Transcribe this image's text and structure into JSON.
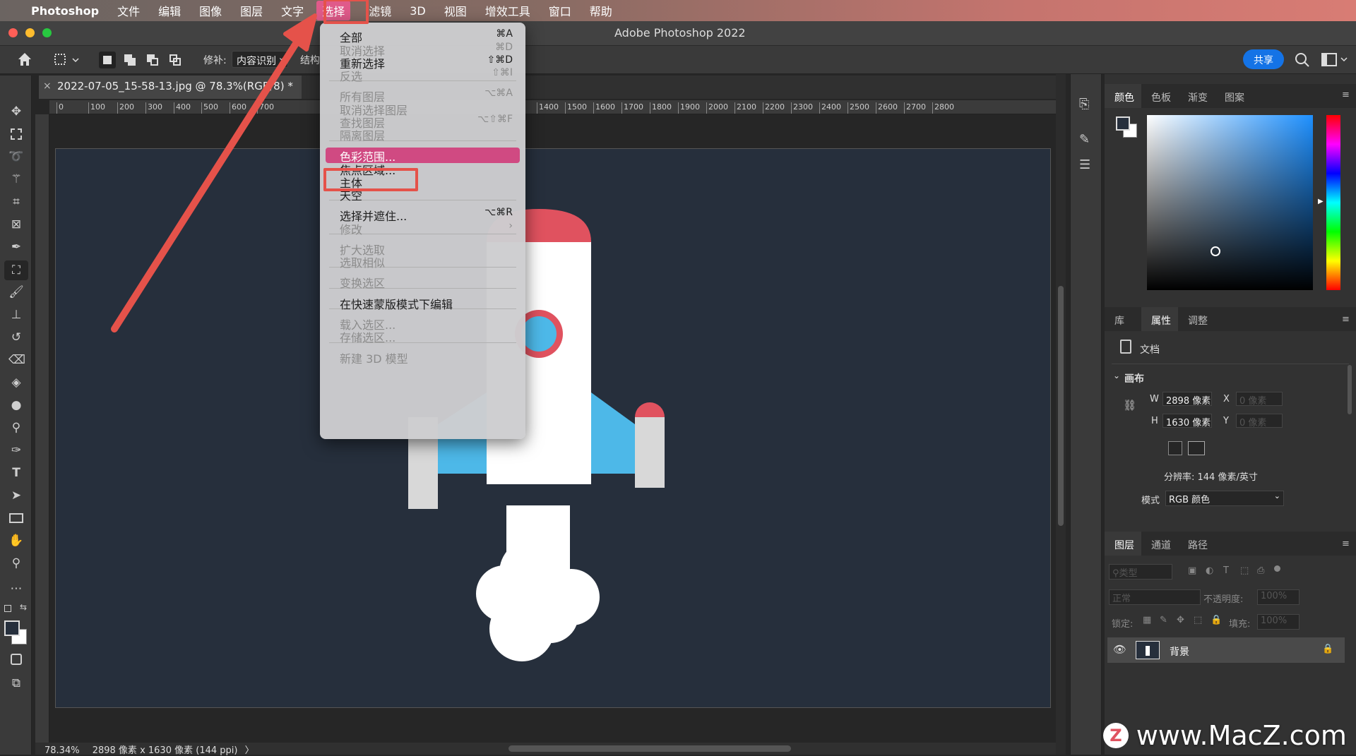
{
  "menubar": {
    "apple": "",
    "app_name": "Photoshop",
    "items": [
      "文件",
      "编辑",
      "图像",
      "图层",
      "文字"
    ],
    "active": "选择",
    "items_after": [
      "滤镜",
      "3D",
      "视图",
      "增效工具",
      "窗口",
      "帮助"
    ]
  },
  "window": {
    "title": "Adobe Photoshop 2022",
    "share_label": "共享"
  },
  "options_bar": {
    "patch_label": "修补:",
    "patch_value": "内容识别",
    "structure_label": "结构"
  },
  "document": {
    "tab_title": "2022-07-05_15-58-13.jpg @ 78.3%(RGB/8) *",
    "close": "×"
  },
  "ruler": {
    "ticks": [
      "0",
      "100",
      "200",
      "300",
      "400",
      "500",
      "600",
      "700",
      "1400",
      "1500",
      "1600",
      "1700",
      "1800",
      "1900",
      "2000",
      "2100",
      "2200",
      "2300",
      "2400",
      "2500",
      "2600",
      "2700",
      "2800"
    ]
  },
  "status": {
    "zoom": "78.34%",
    "info": "2898 像素 x 1630 像素 (144 ppi)",
    "arrow": "〉"
  },
  "select_menu": {
    "items": [
      {
        "label": "全部",
        "shortcut": "⌘A",
        "disabled": false
      },
      {
        "label": "取消选择",
        "shortcut": "⌘D",
        "disabled": true
      },
      {
        "label": "重新选择",
        "shortcut": "⇧⌘D",
        "disabled": false
      },
      {
        "label": "反选",
        "shortcut": "⇧⌘I",
        "disabled": true
      },
      {
        "label": "所有图层",
        "shortcut": "⌥⌘A",
        "disabled": true
      },
      {
        "label": "取消选择图层",
        "shortcut": "",
        "disabled": true
      },
      {
        "label": "查找图层",
        "shortcut": "⌥⇧⌘F",
        "disabled": true
      },
      {
        "label": "隔离图层",
        "shortcut": "",
        "disabled": true
      },
      {
        "label": "色彩范围...",
        "shortcut": "",
        "disabled": false,
        "highlighted": true
      },
      {
        "label": "焦点区域...",
        "shortcut": "",
        "disabled": false
      },
      {
        "label": "主体",
        "shortcut": "",
        "disabled": false
      },
      {
        "label": "天空",
        "shortcut": "",
        "disabled": false
      },
      {
        "label": "选择并遮住...",
        "shortcut": "⌥⌘R",
        "disabled": false
      },
      {
        "label": "修改",
        "shortcut": "›",
        "disabled": true
      },
      {
        "label": "扩大选取",
        "shortcut": "",
        "disabled": true
      },
      {
        "label": "选取相似",
        "shortcut": "",
        "disabled": true
      },
      {
        "label": "变换选区",
        "shortcut": "",
        "disabled": true
      },
      {
        "label": "在快速蒙版模式下编辑",
        "shortcut": "",
        "disabled": false
      },
      {
        "label": "载入选区...",
        "shortcut": "",
        "disabled": true
      },
      {
        "label": "存储选区...",
        "shortcut": "",
        "disabled": true
      },
      {
        "label": "新建 3D 模型",
        "shortcut": "",
        "disabled": true
      }
    ]
  },
  "color_panel": {
    "tabs": [
      "颜色",
      "色板",
      "渐变",
      "图案"
    ],
    "active": "颜色"
  },
  "properties_panel": {
    "tabs": [
      "库",
      "属性",
      "调整"
    ],
    "active": "属性",
    "doc_label": "文档",
    "section": "画布",
    "w_label": "W",
    "w_value": "2898 像素",
    "h_label": "H",
    "h_value": "1630 像素",
    "x_label": "X",
    "x_value": "0 像素",
    "y_label": "Y",
    "y_value": "0 像素",
    "resolution": "分辨率: 144 像素/英寸",
    "mode_label": "模式",
    "mode_value": "RGB 颜色"
  },
  "layers_panel": {
    "tabs": [
      "图层",
      "通道",
      "路径"
    ],
    "active": "图层",
    "filter_placeholder": "类型",
    "blend_mode": "正常",
    "opacity_label": "不透明度:",
    "opacity_value": "100%",
    "lock_label": "锁定:",
    "fill_label": "填充:",
    "fill_value": "100%",
    "layer_name": "背景"
  },
  "watermark": "www.MacZ.com",
  "colors": {
    "accent_pink": "#d04a82",
    "annotation_red": "#e5524a",
    "canvas_bg": "#262f3c",
    "rocket_red": "#e0525f",
    "rocket_blue": "#4db8e8",
    "share_blue": "#1473e6"
  }
}
